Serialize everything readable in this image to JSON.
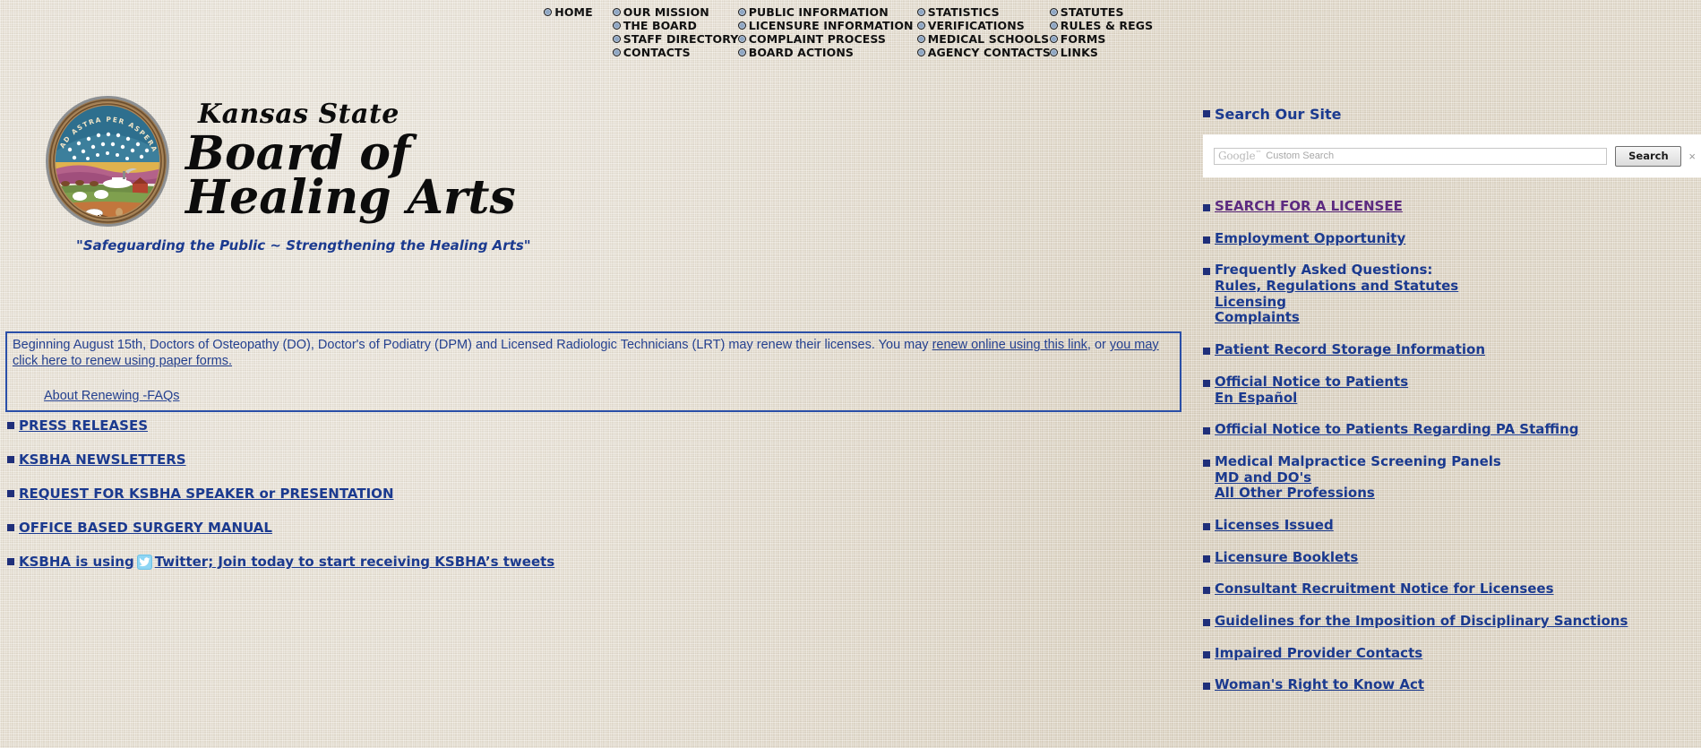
{
  "nav": {
    "columns": [
      {
        "items": [
          {
            "label": "HOME",
            "icon": "radio-bullet-icon"
          }
        ]
      },
      {
        "items": [
          {
            "label": "OUR MISSION",
            "icon": "radio-bullet-icon"
          },
          {
            "label": "THE BOARD",
            "icon": "radio-bullet-icon"
          },
          {
            "label": "STAFF DIRECTORY",
            "icon": "radio-bullet-icon"
          },
          {
            "label": "CONTACTS",
            "icon": "radio-bullet-icon"
          }
        ]
      },
      {
        "items": [
          {
            "label": "PUBLIC INFORMATION",
            "icon": "radio-bullet-icon"
          },
          {
            "label": "LICENSURE INFORMATION",
            "icon": "radio-bullet-icon"
          },
          {
            "label": "COMPLAINT PROCESS",
            "icon": "radio-bullet-icon"
          },
          {
            "label": "BOARD ACTIONS",
            "icon": "radio-bullet-icon"
          }
        ]
      },
      {
        "items": [
          {
            "label": "STATISTICS",
            "icon": "radio-bullet-icon"
          },
          {
            "label": "VERIFICATIONS",
            "icon": "radio-bullet-icon"
          },
          {
            "label": "MEDICAL SCHOOLS",
            "icon": "radio-bullet-icon"
          },
          {
            "label": "AGENCY CONTACTS",
            "icon": "radio-bullet-icon"
          }
        ]
      },
      {
        "items": [
          {
            "label": "STATUTES",
            "icon": "radio-bullet-icon"
          },
          {
            "label": "RULES & REGS",
            "icon": "radio-bullet-icon"
          },
          {
            "label": "FORMS",
            "icon": "radio-bullet-icon"
          },
          {
            "label": "LINKS",
            "icon": "radio-bullet-icon"
          }
        ]
      }
    ]
  },
  "header": {
    "seal_motto": "AD ASTRA PER ASPERA",
    "line1": "Kansas State",
    "line2": "Board of",
    "line3": "Healing Arts",
    "tagline": "\"Safeguarding the Public ~ Strengthening the Healing Arts\""
  },
  "announcement": {
    "text_part1": "Beginning August 15th, Doctors of Osteopathy (DO), Doctor's of Podiatry (DPM) and Licensed Radiologic Technicians (LRT) may renew their licenses. You may ",
    "link1": "renew online using this link",
    "text_part2": ", or ",
    "link2": "you may click here to renew using paper forms.",
    "faq_link": "About Renewing -FAQs"
  },
  "left_links": [
    {
      "label": "PRESS RELEASES",
      "icon": "blue-square-bullet-icon"
    },
    {
      "label": "KSBHA NEWSLETTERS",
      "icon": "blue-square-bullet-icon"
    },
    {
      "label": "REQUEST FOR KSBHA SPEAKER or PRESENTATION",
      "icon": "blue-square-bullet-icon"
    },
    {
      "label": "OFFICE BASED SURGERY MANUAL",
      "icon": "blue-square-bullet-icon"
    }
  ],
  "twitter_row": {
    "prefix": "KSBHA is using",
    "icon": "twitter-bird-icon",
    "suffix": "Twitter; Join today to start receiving KSBHA’s tweets"
  },
  "search": {
    "heading": "Search Our Site",
    "logo_text": "Google",
    "logo_sup": "™",
    "placeholder": "Custom Search",
    "value": "",
    "button_label": "Search",
    "close_label": "×"
  },
  "right_links": [
    {
      "label": "SEARCH FOR A LICENSEE",
      "state": "visited",
      "icon": "blue-square-bullet-icon",
      "sub": []
    },
    {
      "label": "Employment Opportunity",
      "state": "link",
      "icon": "blue-square-bullet-icon",
      "sub": []
    },
    {
      "label": "Frequently Asked Questions:",
      "state": "plain",
      "icon": "blue-square-bullet-icon",
      "sub": [
        "Rules, Regulations and Statutes",
        "Licensing",
        "Complaints"
      ]
    },
    {
      "label": "Patient Record Storage Information",
      "state": "link",
      "icon": "blue-square-bullet-icon",
      "sub": []
    },
    {
      "label": "Official Notice to Patients",
      "state": "link",
      "icon": "blue-square-bullet-icon",
      "sub": [
        "En Español"
      ]
    },
    {
      "label": "Official Notice to Patients Regarding PA Staffing",
      "state": "link",
      "icon": "blue-square-bullet-icon",
      "sub": []
    },
    {
      "label": "Medical Malpractice Screening Panels",
      "state": "plain",
      "icon": "blue-square-bullet-icon",
      "sub": [
        "MD and DO's",
        "All Other Professions"
      ]
    },
    {
      "label": "Licenses Issued",
      "state": "link",
      "icon": "blue-square-bullet-icon",
      "sub": []
    },
    {
      "label": "Licensure Booklets",
      "state": "link",
      "icon": "blue-square-bullet-icon",
      "sub": []
    },
    {
      "label": "Consultant Recruitment Notice for Licensees",
      "state": "link",
      "icon": "blue-square-bullet-icon",
      "sub": []
    },
    {
      "label": "Guidelines for the Imposition of Disciplinary Sanctions",
      "state": "link",
      "icon": "blue-square-bullet-icon",
      "sub": []
    },
    {
      "label": "Impaired Provider Contacts",
      "state": "link",
      "icon": "blue-square-bullet-icon",
      "sub": []
    },
    {
      "label": "Woman's Right to Know Act",
      "state": "link",
      "icon": "blue-square-bullet-icon",
      "sub": []
    }
  ],
  "colors": {
    "background": "#e4dccd",
    "link": "#1b3a8f",
    "visited_link": "#5c2a80",
    "bullet": "#1f2f7a",
    "announce_border": "#2a4fa8",
    "announce_text": "#24408f"
  }
}
